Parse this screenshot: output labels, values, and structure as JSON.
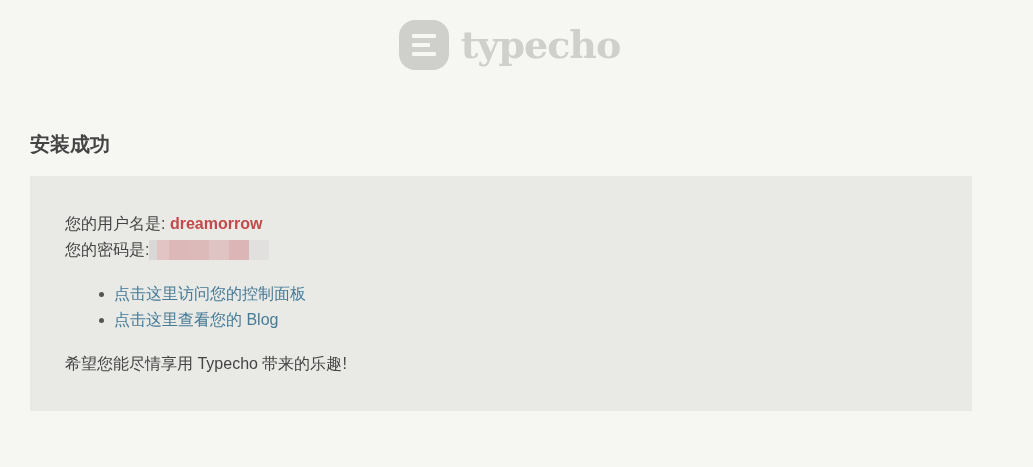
{
  "logo": {
    "text": "typecho"
  },
  "heading": "安装成功",
  "panel": {
    "username_line": "您的用户名是: **dreamorrow**",
    "password_label": "您的密码是:",
    "links": [
      {
        "label": "点击这里访问您的控制面板"
      },
      {
        "label": "点击这里查看您的 Blog"
      }
    ],
    "closing": "希望您能尽情享用 Typecho 带来的乐趣!"
  }
}
